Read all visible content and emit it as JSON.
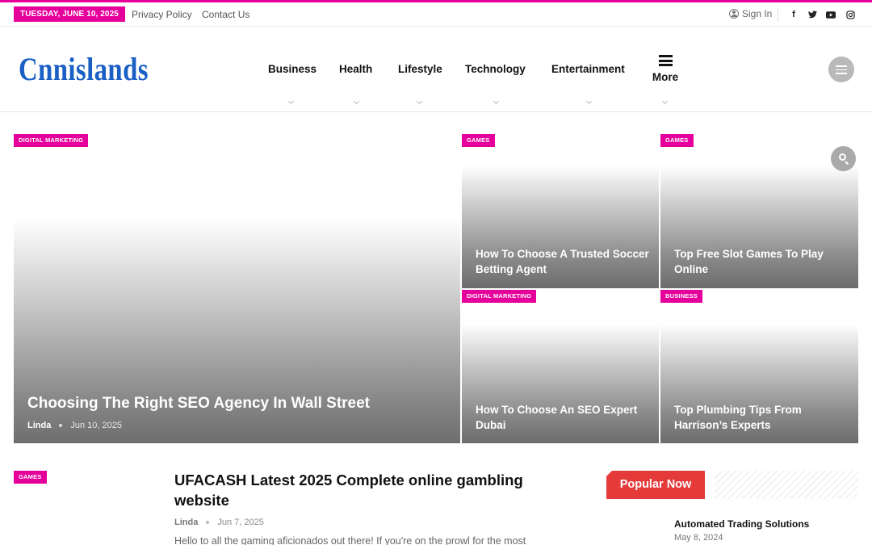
{
  "topbar": {
    "date": "TUESDAY, JUNE 10, 2025",
    "links": [
      "Privacy Policy",
      "Contact Us"
    ],
    "sign_in": "Sign In",
    "social_icons": [
      "facebook-icon",
      "twitter-icon",
      "youtube-icon",
      "instagram-icon"
    ]
  },
  "header": {
    "logo": "Cnnislands",
    "nav": [
      "Business",
      "Health",
      "Lifestyle",
      "Technology",
      "Entertainment"
    ],
    "more_label": "More"
  },
  "featured": {
    "main": {
      "category": "DIGITAL MARKETING",
      "title": "Choosing The Right SEO Agency In Wall Street",
      "author": "Linda",
      "date": "Jun 10, 2025"
    },
    "grid": [
      {
        "category": "GAMES",
        "title": "How To Choose A Trusted Soccer Betting Agent"
      },
      {
        "category": "GAMES",
        "title": "Top Free Slot Games To Play Online"
      },
      {
        "category": "DIGITAL MARKETING",
        "title": "How To Choose An SEO Expert Dubai"
      },
      {
        "category": "BUSINESS",
        "title": "Top Plumbing Tips From Harrison’s Experts"
      }
    ]
  },
  "latest_post": {
    "category": "GAMES",
    "title": "UFACASH Latest 2025 Complete online gambling website",
    "author": "Linda",
    "date": "Jun 7, 2025",
    "excerpt": "Hello to all the gaming aficionados out there! If you're on the prowl for the most"
  },
  "popular": {
    "heading": "Popular Now",
    "items": [
      {
        "title": "Automated Trading Solutions",
        "date": "May 8, 2024"
      }
    ]
  },
  "colors": {
    "accent": "#e5009b",
    "logo": "#1a5fc4",
    "popular_heading": "#e53a3a"
  }
}
